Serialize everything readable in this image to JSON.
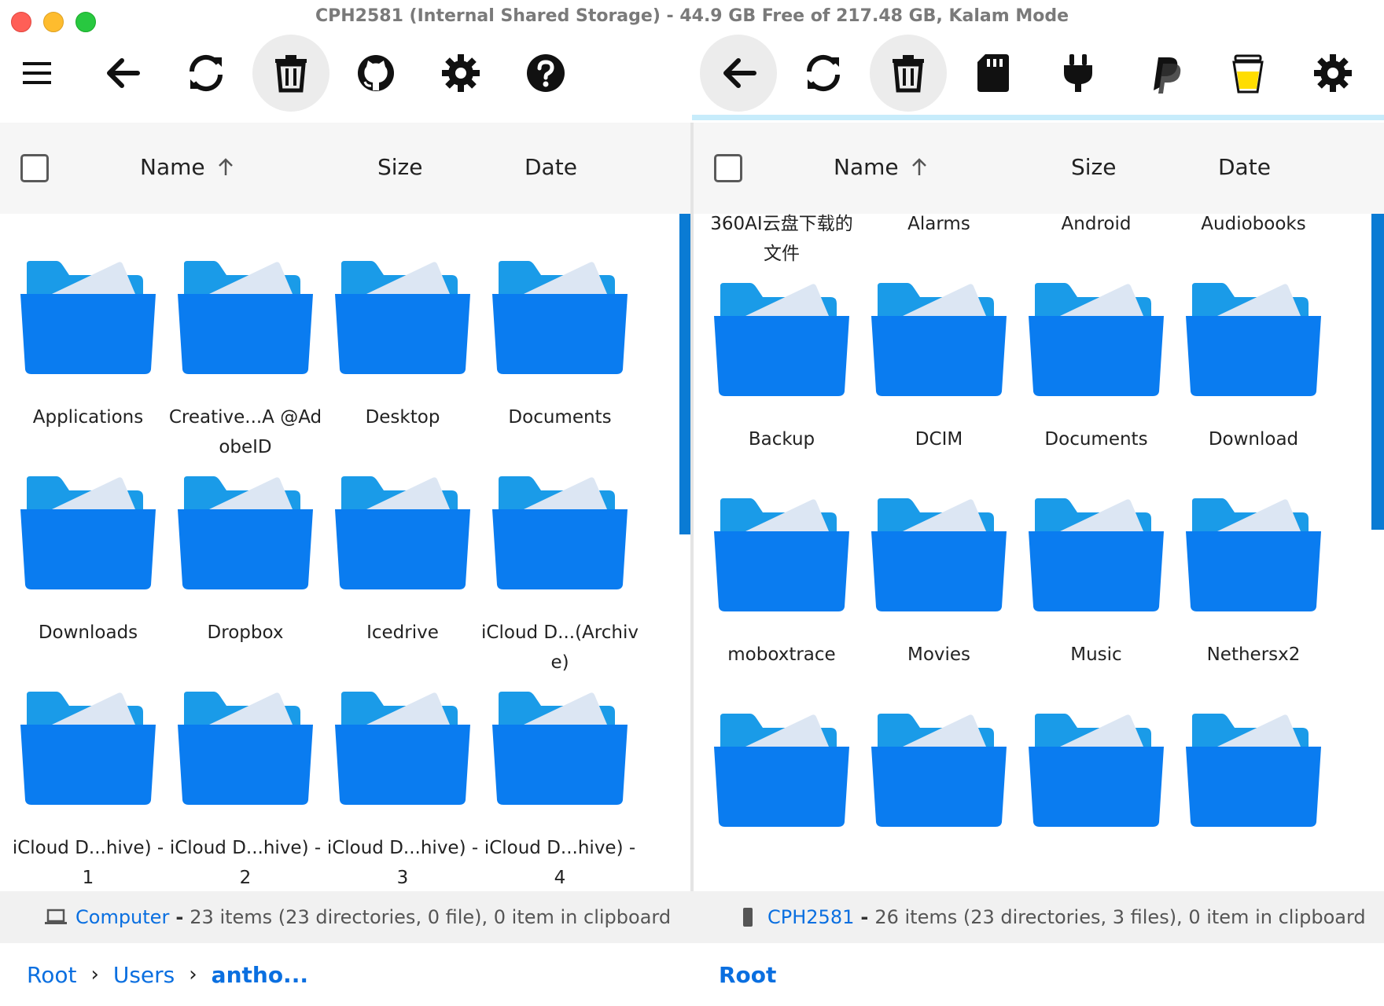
{
  "window": {
    "title": "CPH2581 (Internal Shared Storage) - 44.9 GB Free of 217.48 GB, Kalam Mode"
  },
  "toolbar_left": [
    "menu-icon",
    "back-arrow-icon",
    "refresh-icon",
    "trash-icon",
    "github-icon",
    "gear-icon",
    "help-icon"
  ],
  "toolbar_right": [
    "back-arrow-icon",
    "refresh-icon",
    "trash-icon",
    "sd-card-icon",
    "plug-icon",
    "paypal-icon",
    "coffee-cup-icon",
    "gear-icon"
  ],
  "colors": {
    "accent": "#0a6fe0",
    "folder_back": "#1a9be8",
    "folder_front": "#0a7cf0",
    "paper": "#dce6f3",
    "scrollbar": "#0a7bd4"
  },
  "left_pane": {
    "columns": {
      "name": "Name",
      "size": "Size",
      "date": "Date"
    },
    "items": [
      {
        "label": "Applications"
      },
      {
        "label": "Creative...A @AdobeID"
      },
      {
        "label": "Desktop"
      },
      {
        "label": "Documents"
      },
      {
        "label": "Downloads"
      },
      {
        "label": "Dropbox"
      },
      {
        "label": "Icedrive"
      },
      {
        "label": "iCloud D...(Archive)"
      },
      {
        "label": "iCloud D...hive) - 1"
      },
      {
        "label": "iCloud D...hive) - 2"
      },
      {
        "label": "iCloud D...hive) - 3"
      },
      {
        "label": "iCloud D...hive) - 4"
      }
    ],
    "status": {
      "device": "Computer",
      "separator": "-",
      "summary": "23 items (23 directories, 0 file), 0 item in clipboard"
    },
    "breadcrumb": [
      "Root",
      "Users",
      "antho..."
    ]
  },
  "right_pane": {
    "columns": {
      "name": "Name",
      "size": "Size",
      "date": "Date"
    },
    "items": [
      {
        "label": "360AI云盘下载的文件"
      },
      {
        "label": "Alarms"
      },
      {
        "label": "Android"
      },
      {
        "label": "Audiobooks"
      },
      {
        "label": "Backup"
      },
      {
        "label": "DCIM"
      },
      {
        "label": "Documents"
      },
      {
        "label": "Download"
      },
      {
        "label": "moboxtrace"
      },
      {
        "label": "Movies"
      },
      {
        "label": "Music"
      },
      {
        "label": "Nethersx2"
      },
      {
        "label": ""
      },
      {
        "label": ""
      },
      {
        "label": ""
      },
      {
        "label": ""
      }
    ],
    "status": {
      "device": "CPH2581",
      "separator": "-",
      "summary": "26 items (23 directories, 3 files), 0 item in clipboard"
    },
    "breadcrumb": [
      "Root"
    ]
  }
}
